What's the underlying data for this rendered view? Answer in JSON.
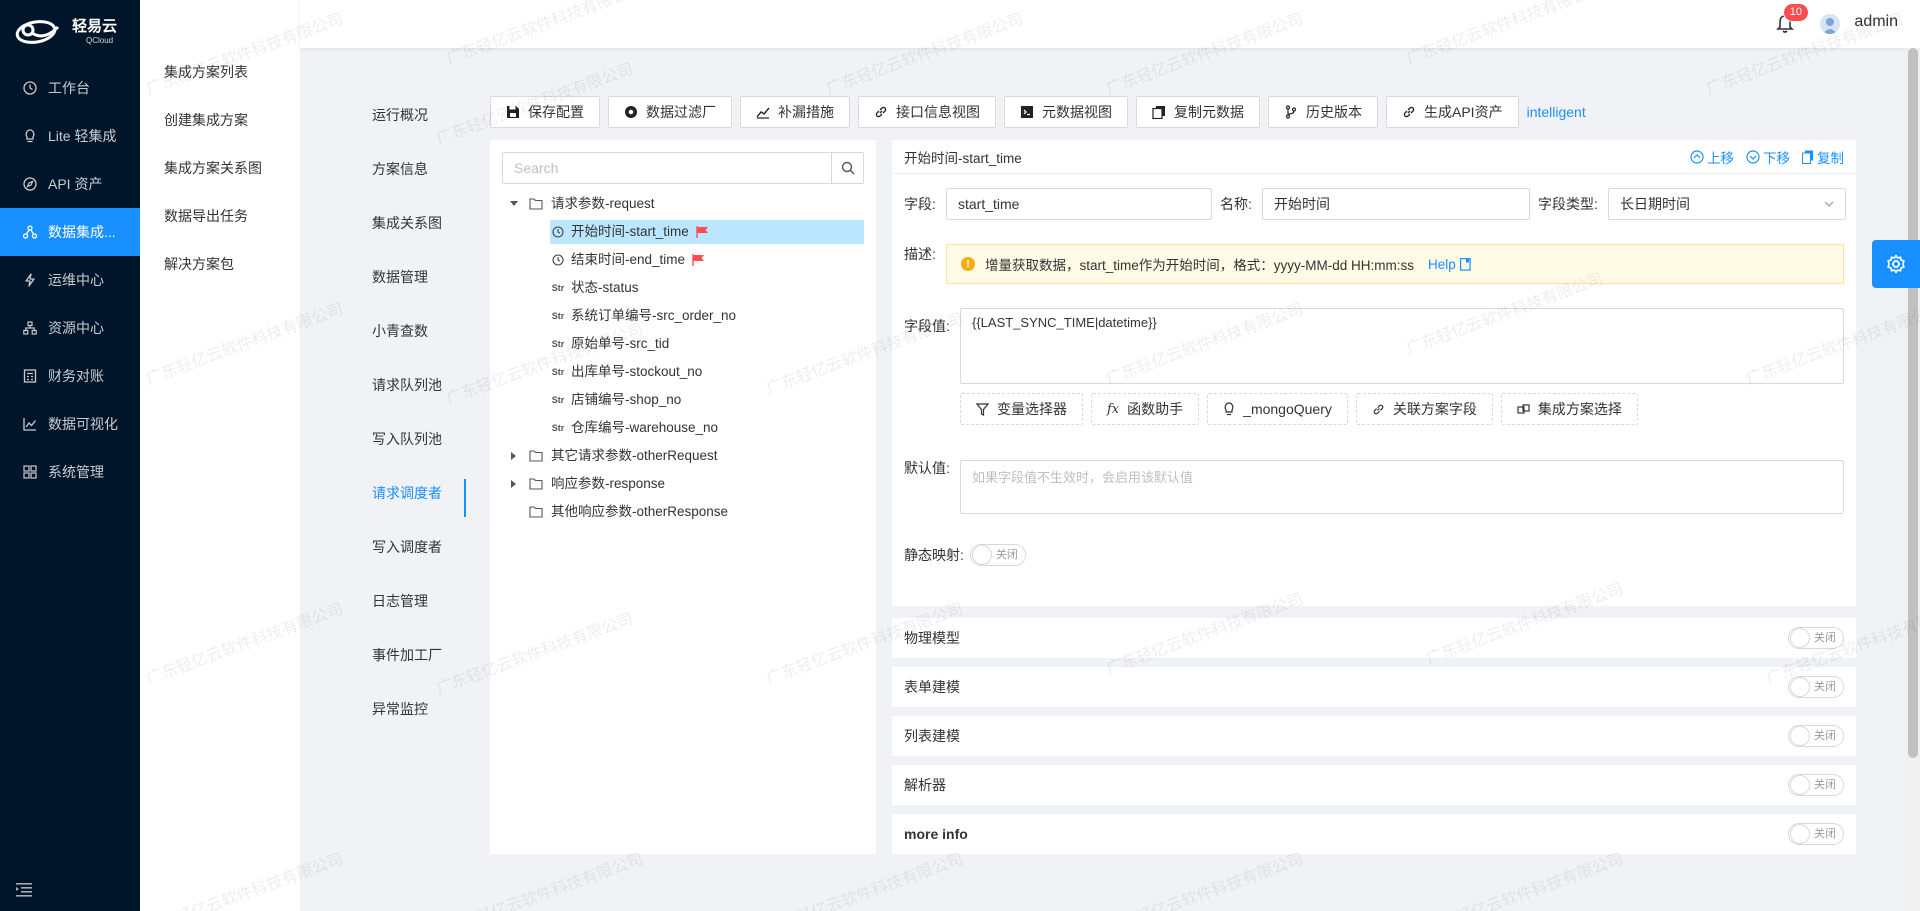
{
  "app": {
    "logo_cn": "轻易云",
    "logo_en": "QCloud"
  },
  "sidebar": {
    "items": [
      {
        "label": "工作台",
        "icon": "clock-icon"
      },
      {
        "label": "Lite 轻集成",
        "icon": "bulb-icon"
      },
      {
        "label": "API 资产",
        "icon": "compass-icon"
      },
      {
        "label": "数据集成...",
        "icon": "cluster-icon",
        "active": true
      },
      {
        "label": "运维中心",
        "icon": "thunder-icon"
      },
      {
        "label": "资源中心",
        "icon": "apartment-icon"
      },
      {
        "label": "财务对账",
        "icon": "calculator-icon"
      },
      {
        "label": "数据可视化",
        "icon": "chart-icon"
      },
      {
        "label": "系统管理",
        "icon": "appstore-icon"
      }
    ]
  },
  "subnav": {
    "items": [
      "集成方案列表",
      "创建集成方案",
      "集成方案关系图",
      "数据导出任务",
      "解决方案包"
    ]
  },
  "header": {
    "notification_count": "10",
    "username": "admin"
  },
  "vtabs": {
    "items": [
      "运行概况",
      "方案信息",
      "集成关系图",
      "数据管理",
      "小青查数",
      "请求队列池",
      "写入队列池",
      "请求调度者",
      "写入调度者",
      "日志管理",
      "事件加工厂",
      "异常监控"
    ],
    "active_index": 7
  },
  "toolbar": {
    "buttons": [
      "保存配置",
      "数据过滤厂",
      "补漏措施",
      "接口信息视图",
      "元数据视图",
      "复制元数据",
      "历史版本",
      "生成API资产"
    ],
    "link": "intelligent"
  },
  "tree": {
    "search_placeholder": "Search",
    "nodes": [
      {
        "label": "请求参数-request",
        "level": 0,
        "expanded": true
      },
      {
        "label": "开始时间-start_time",
        "level": 1,
        "type": "time",
        "flag": true,
        "selected": true
      },
      {
        "label": "结束时间-end_time",
        "level": 1,
        "type": "time",
        "flag": true
      },
      {
        "label": "状态-status",
        "level": 1,
        "type": "str"
      },
      {
        "label": "系统订单编号-src_order_no",
        "level": 1,
        "type": "str"
      },
      {
        "label": "原始单号-src_tid",
        "level": 1,
        "type": "str"
      },
      {
        "label": "出库单号-stockout_no",
        "level": 1,
        "type": "str"
      },
      {
        "label": "店铺编号-shop_no",
        "level": 1,
        "type": "str"
      },
      {
        "label": "仓库编号-warehouse_no",
        "level": 1,
        "type": "str"
      },
      {
        "label": "其它请求参数-otherRequest",
        "level": 0,
        "expanded": false
      },
      {
        "label": "响应参数-response",
        "level": 0,
        "expanded": false
      },
      {
        "label": "其他响应参数-otherResponse",
        "level": 0,
        "leaf": true
      }
    ],
    "str_tag": "Str"
  },
  "detail": {
    "title": "开始时间-start_time",
    "actions": {
      "up": "上移",
      "down": "下移",
      "copy": "复制"
    },
    "field_label": "字段:",
    "field_value": "start_time",
    "name_label": "名称:",
    "name_value": "开始时间",
    "type_label": "字段类型:",
    "type_value": "长日期时间",
    "desc_label": "描述:",
    "desc_text": "增量获取数据，start_time作为开始时间，格式：yyyy-MM-dd HH:mm:ss",
    "help": "Help",
    "value_label": "字段值:",
    "value_text": "{{LAST_SYNC_TIME|datetime}}",
    "helpers": [
      "变量选择器",
      "函数助手",
      "_mongoQuery",
      "关联方案字段",
      "集成方案选择"
    ],
    "default_label": "默认值:",
    "default_placeholder": "如果字段值不生效时，会启用该默认值",
    "static_label": "静态映射:",
    "switch_off": "关闭"
  },
  "sections": [
    "物理模型",
    "表单建模",
    "列表建模",
    "解析器",
    "more info"
  ],
  "watermark": "广东轻亿云软件科技有限公司",
  "colors": {
    "primary": "#1890ff",
    "sidebar_bg": "#001529",
    "flag": "#ff4d4f"
  }
}
